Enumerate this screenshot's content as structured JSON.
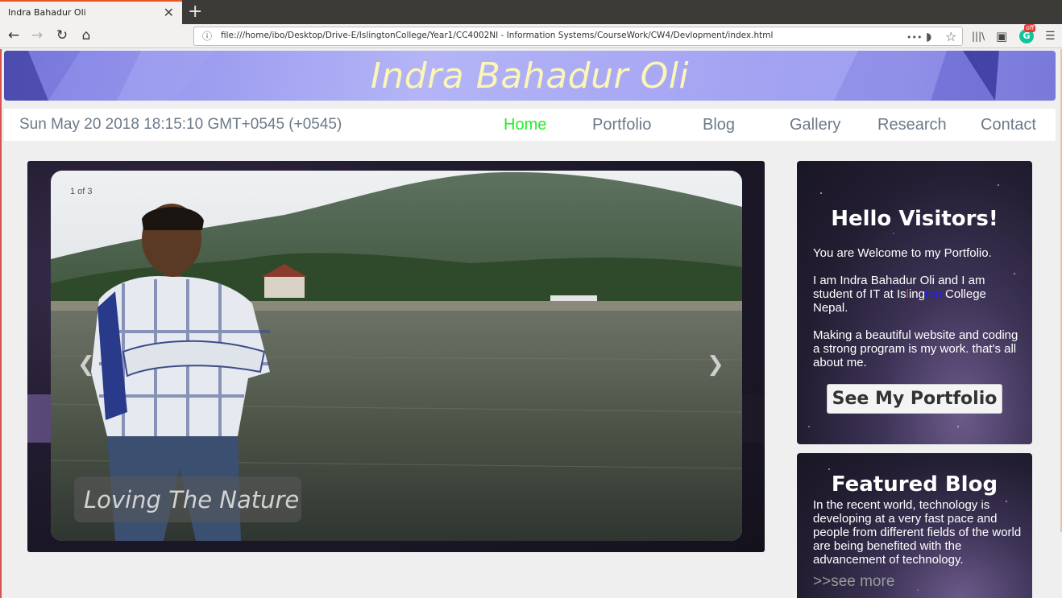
{
  "browser": {
    "tab_title": "Indra Bahadur Oli",
    "tab_close": "✕",
    "new_tab": "+",
    "url": "file:///home/ibo/Desktop/Drive-E/IslingtonCollege/Year1/CC4002NI - Information Systems/CourseWork/CW4/Devlopment/index.html",
    "back_icon": "←",
    "forward_icon": "→",
    "reload_icon": "↻",
    "home_icon": "⌂",
    "info_icon": "ⓘ",
    "more_icon": "•••",
    "pocket_icon": "◗",
    "star_icon": "☆",
    "library_icon": "|||\\",
    "sidebar_icon": "▣",
    "grammarly_icon": "G",
    "grammarly_badge": "off",
    "menu_icon": "☰"
  },
  "header": {
    "title": "Indra Bahadur Oli"
  },
  "menubar": {
    "datetime": "Sun May 20 2018 18:15:10 GMT+0545 (+0545)",
    "items": [
      {
        "label": "Home",
        "active": true
      },
      {
        "label": "Portfolio"
      },
      {
        "label": "Blog"
      },
      {
        "label": "Gallery"
      },
      {
        "label": "Research"
      },
      {
        "label": "Contact"
      }
    ]
  },
  "slider": {
    "counter": "1 of 3",
    "prev": "❮",
    "next": "❯",
    "caption": "Loving The Nature"
  },
  "welcome_card": {
    "heading": "Hello Visitors!",
    "para1": "You are Welcome to my Portfolio.",
    "para2_before": "I am Indra Bahadur Oli and I am student of IT at ",
    "para2_is": "Is",
    "para2_l": "l",
    "para2_ing": "ing",
    "para2_ton": "ton",
    "para2_after": " College Nepal.",
    "para3": "Making a beautiful website and coding a strong program is my work. that's all about me.",
    "button": "See My Portfolio"
  },
  "blog_card": {
    "heading": "Featured Blog",
    "text": "In the recent world, technology is developing at a very fast pace and people from different fields of the world are being benefited with the advancement of technology.",
    "see_more": ">>see more"
  },
  "colors": {
    "active_menu": "#22ee22",
    "menu_text": "#6c7a89",
    "banner_title": "#fbf6b8"
  }
}
